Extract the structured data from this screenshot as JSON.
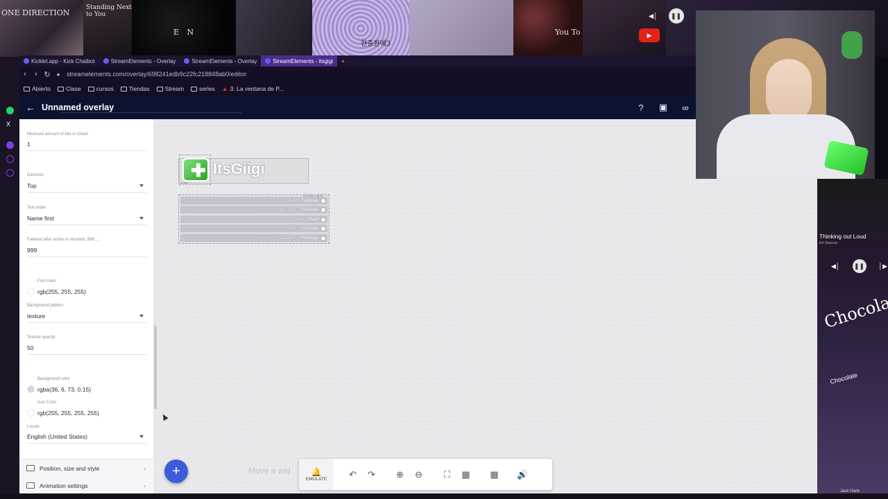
{
  "wallpaper": {
    "tile_text_1": "ONE DIRECTION",
    "tile_text_2": "Standing Next to You",
    "tile_text_3": "E N",
    "tile_text_4": "현충원에3",
    "tile_text_5": "You To"
  },
  "browser": {
    "tabs": [
      {
        "label": "Kicklet.app - Kick Chatbot",
        "active": false
      },
      {
        "label": "StreamElements - Overlay",
        "active": false
      },
      {
        "label": "StreamElements - Overlay",
        "active": false
      },
      {
        "label": "StreamElements - itsgigi",
        "active": true
      }
    ],
    "new_tab": "+",
    "url": "streamelements.com/overlay/698241edb9c22fc218848ab0/editor",
    "bookmarks": [
      "Abierto",
      "Clase",
      "cursos",
      "Tiendas",
      "Stream",
      "series",
      "3. La ventana de P..."
    ]
  },
  "header": {
    "title": "Unnamed overlay",
    "back_icon": "arrow-left-icon",
    "icons": [
      "help-icon",
      "preview-icon",
      "link-icon"
    ]
  },
  "settings": {
    "min_bits": {
      "label": "Minimum amount of bits in Cheer",
      "value": "1"
    },
    "direction": {
      "label": "Direction",
      "value": "Top"
    },
    "text_order": {
      "label": "Text order",
      "value": "Name first"
    },
    "fadeout": {
      "label": "Fadeout after action in seconds, 999 ...",
      "value": "999"
    },
    "font_color": {
      "label": "Font color",
      "value": "rgb(255, 255, 255)",
      "swatch": "#ffffff"
    },
    "background_pattern": {
      "label": "Background pattern",
      "value": "texture"
    },
    "texture_opacity": {
      "label": "Texture opacity",
      "value": "50"
    },
    "background_color": {
      "label": "Background color",
      "value": "rgba(36, 6, 73, 0.15)",
      "swatch": "#d8d4de"
    },
    "icon_color": {
      "label": "Icon Color",
      "value": "rgb(255, 255, 255, 255)",
      "swatch": "#ffffff"
    },
    "locale": {
      "label": "Locale",
      "value": "English (United States)"
    }
  },
  "accordion": {
    "position": "Position, size and style",
    "animation": "Animation settings"
  },
  "canvas": {
    "name_widget_text": "ItsGiigi",
    "gift_caption": "image",
    "feed_header": "CR 60% x 16.57",
    "feed": [
      {
        "user": "imkitoh",
        "action": "Followe"
      },
      {
        "user": "max_lova...",
        "action": "Followe"
      },
      {
        "user": "nyxbara",
        "action": "Raid"
      },
      {
        "user": "fvrt_carlo...",
        "action": "Followe"
      },
      {
        "user": "daavid_...",
        "action": "Followe"
      }
    ],
    "hint": "Move a wid",
    "add_button": "+"
  },
  "toolbar": {
    "emulate_label": "EMULATE",
    "icons": [
      "undo-icon",
      "redo-icon",
      "zoom-in-icon",
      "zoom-out-icon",
      "fullscreen-icon",
      "fit-icon",
      "grid-icon",
      "sound-icon"
    ]
  },
  "media": {
    "song": "Thinking out Loud",
    "song_sub": "Ed Sheeran",
    "artwork_text": "Chocolate",
    "artwork_text_2": "Chocolate",
    "artist": "Jack Harlo"
  },
  "colors": {
    "accent": "#3b5bdb",
    "header_bg": "#0b1330",
    "tab_active": "#4b2d8f",
    "youtube_red": "#e62117"
  }
}
